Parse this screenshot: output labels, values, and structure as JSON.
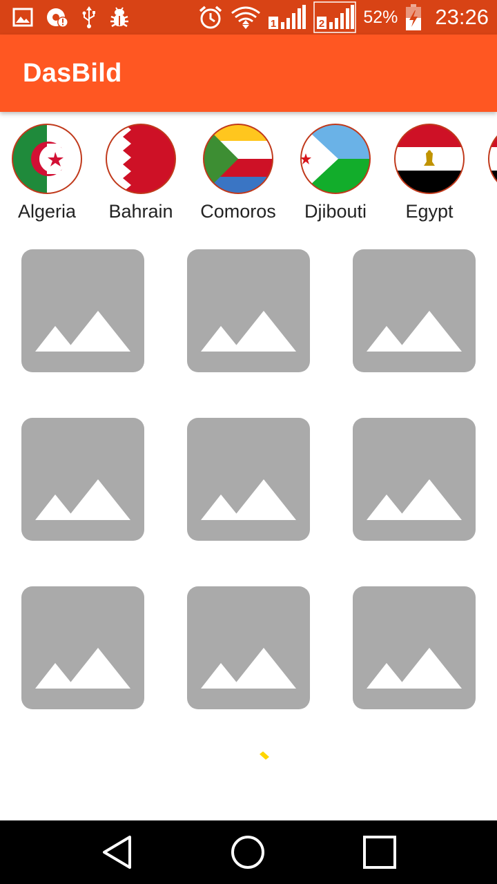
{
  "status_bar": {
    "background": "#d84315",
    "left_icons": [
      "image-icon",
      "sync-alert-icon",
      "usb-icon",
      "bug-icon"
    ],
    "right_icons": [
      "alarm-icon",
      "wifi-icon",
      "signal-sim1-icon",
      "signal-sim2-icon"
    ],
    "battery_percent": "52%",
    "battery_icon": "battery-charging-icon",
    "time": "23:26"
  },
  "toolbar": {
    "title": "DasBild",
    "background": "#ff5722"
  },
  "countries": [
    {
      "name": "Algeria"
    },
    {
      "name": "Bahrain"
    },
    {
      "name": "Comoros"
    },
    {
      "name": "Djibouti"
    },
    {
      "name": "Egypt"
    }
  ],
  "grid": {
    "columns": 3,
    "rows": 3,
    "placeholder_icon": "image-placeholder-icon",
    "placeholder_color": "#aaaaaa"
  },
  "loading": {
    "icon": "loading-spinner-icon",
    "color": "#ffd600"
  },
  "nav_bar": {
    "buttons": [
      "back-icon",
      "home-icon",
      "recents-icon"
    ]
  }
}
